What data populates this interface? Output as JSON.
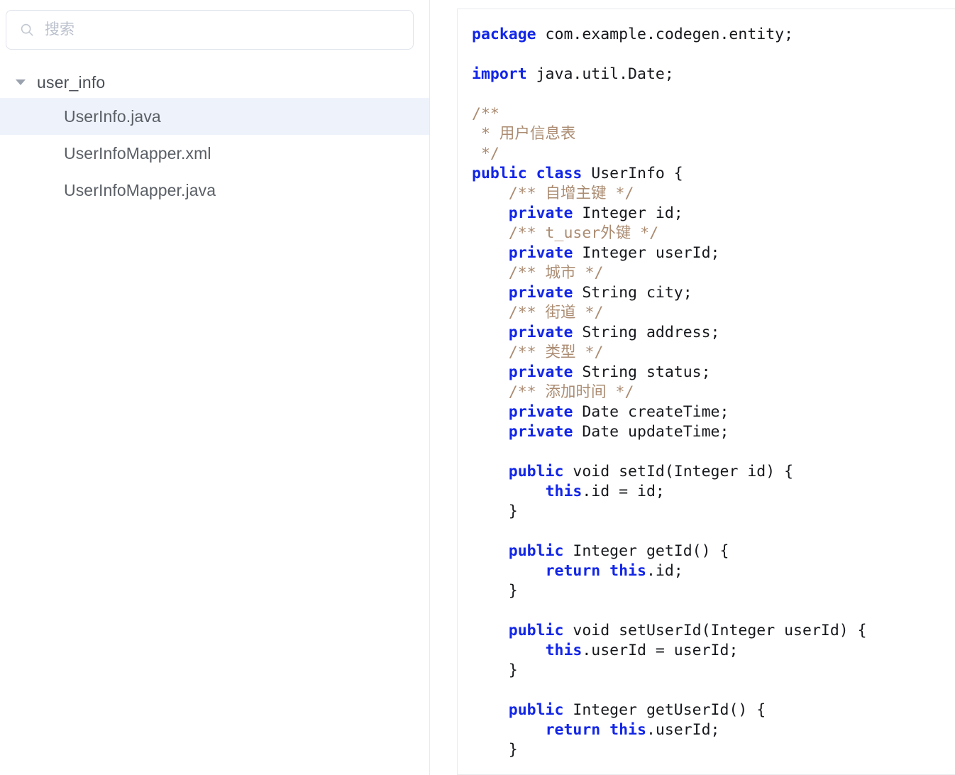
{
  "sidebar": {
    "search": {
      "placeholder": "搜索",
      "value": "",
      "icon": "search-icon"
    },
    "tree": {
      "group": {
        "label": "user_info",
        "expanded": true,
        "caret_icon": "chevron-down-icon"
      },
      "items": [
        {
          "label": "UserInfo.java",
          "selected": true
        },
        {
          "label": "UserInfoMapper.xml",
          "selected": false
        },
        {
          "label": "UserInfoMapper.java",
          "selected": false
        }
      ]
    }
  },
  "editor": {
    "language": "java",
    "colors": {
      "keyword": "#1226e8",
      "comment": "#ab8c72",
      "plain": "#16181c",
      "background": "#ffffff",
      "selection_row": "#eef3fb",
      "border": "#e9ebee"
    },
    "lines": [
      [
        {
          "t": "k",
          "s": "package"
        },
        {
          "t": "pl",
          "s": " com.example.codegen.entity;"
        }
      ],
      [
        {
          "t": "pl",
          "s": ""
        }
      ],
      [
        {
          "t": "k",
          "s": "import"
        },
        {
          "t": "pl",
          "s": " java.util.Date;"
        }
      ],
      [
        {
          "t": "pl",
          "s": ""
        }
      ],
      [
        {
          "t": "cm",
          "s": "/**"
        }
      ],
      [
        {
          "t": "cm",
          "s": " * 用户信息表"
        }
      ],
      [
        {
          "t": "cm",
          "s": " */"
        }
      ],
      [
        {
          "t": "k",
          "s": "public class"
        },
        {
          "t": "pl",
          "s": " UserInfo {"
        }
      ],
      [
        {
          "t": "cm",
          "s": "    /** 自增主键 */"
        }
      ],
      [
        {
          "t": "k",
          "s": "    private"
        },
        {
          "t": "pl",
          "s": " Integer id;"
        }
      ],
      [
        {
          "t": "cm",
          "s": "    /** t_user外键 */"
        }
      ],
      [
        {
          "t": "k",
          "s": "    private"
        },
        {
          "t": "pl",
          "s": " Integer userId;"
        }
      ],
      [
        {
          "t": "cm",
          "s": "    /** 城市 */"
        }
      ],
      [
        {
          "t": "k",
          "s": "    private"
        },
        {
          "t": "pl",
          "s": " String city;"
        }
      ],
      [
        {
          "t": "cm",
          "s": "    /** 街道 */"
        }
      ],
      [
        {
          "t": "k",
          "s": "    private"
        },
        {
          "t": "pl",
          "s": " String address;"
        }
      ],
      [
        {
          "t": "cm",
          "s": "    /** 类型 */"
        }
      ],
      [
        {
          "t": "k",
          "s": "    private"
        },
        {
          "t": "pl",
          "s": " String status;"
        }
      ],
      [
        {
          "t": "cm",
          "s": "    /** 添加时间 */"
        }
      ],
      [
        {
          "t": "k",
          "s": "    private"
        },
        {
          "t": "pl",
          "s": " Date createTime;"
        }
      ],
      [
        {
          "t": "k",
          "s": "    private"
        },
        {
          "t": "pl",
          "s": " Date updateTime;"
        }
      ],
      [
        {
          "t": "pl",
          "s": ""
        }
      ],
      [
        {
          "t": "k",
          "s": "    public"
        },
        {
          "t": "pl",
          "s": " void setId(Integer id) {"
        }
      ],
      [
        {
          "t": "pl",
          "s": "        "
        },
        {
          "t": "k",
          "s": "this"
        },
        {
          "t": "pl",
          "s": ".id = id;"
        }
      ],
      [
        {
          "t": "pl",
          "s": "    }"
        }
      ],
      [
        {
          "t": "pl",
          "s": ""
        }
      ],
      [
        {
          "t": "k",
          "s": "    public"
        },
        {
          "t": "pl",
          "s": " Integer getId() {"
        }
      ],
      [
        {
          "t": "pl",
          "s": "        "
        },
        {
          "t": "k",
          "s": "return this"
        },
        {
          "t": "pl",
          "s": ".id;"
        }
      ],
      [
        {
          "t": "pl",
          "s": "    }"
        }
      ],
      [
        {
          "t": "pl",
          "s": ""
        }
      ],
      [
        {
          "t": "k",
          "s": "    public"
        },
        {
          "t": "pl",
          "s": " void setUserId(Integer userId) {"
        }
      ],
      [
        {
          "t": "pl",
          "s": "        "
        },
        {
          "t": "k",
          "s": "this"
        },
        {
          "t": "pl",
          "s": ".userId = userId;"
        }
      ],
      [
        {
          "t": "pl",
          "s": "    }"
        }
      ],
      [
        {
          "t": "pl",
          "s": ""
        }
      ],
      [
        {
          "t": "k",
          "s": "    public"
        },
        {
          "t": "pl",
          "s": " Integer getUserId() {"
        }
      ],
      [
        {
          "t": "pl",
          "s": "        "
        },
        {
          "t": "k",
          "s": "return this"
        },
        {
          "t": "pl",
          "s": ".userId;"
        }
      ],
      [
        {
          "t": "pl",
          "s": "    }"
        }
      ]
    ]
  }
}
